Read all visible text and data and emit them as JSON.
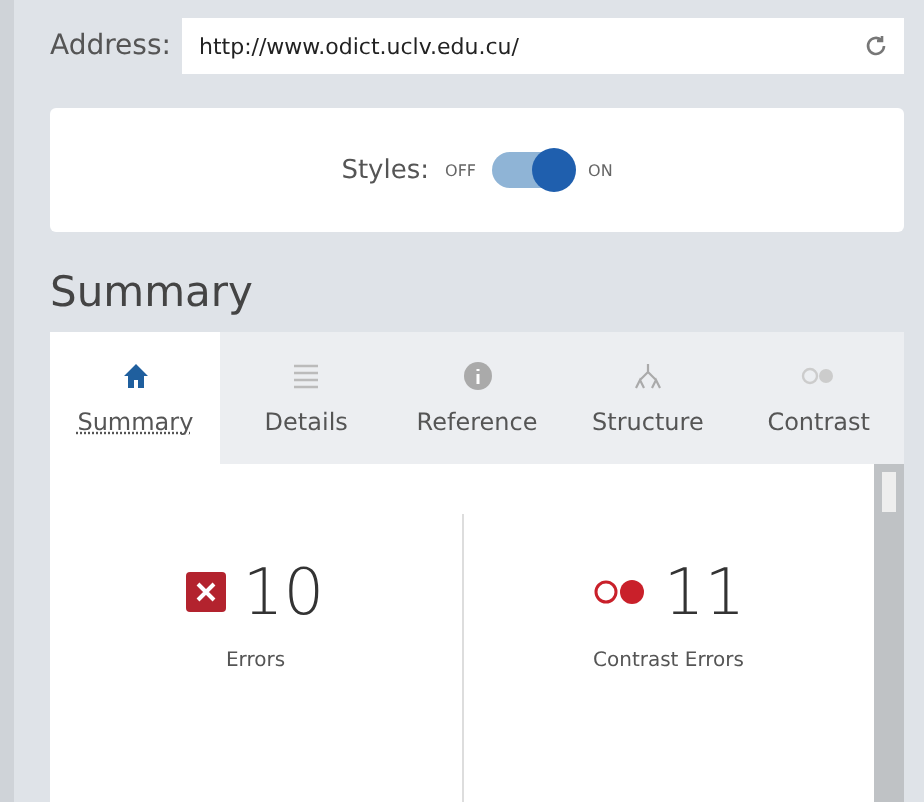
{
  "address": {
    "label": "Address:",
    "value": "http://www.odict.uclv.edu.cu/"
  },
  "styles": {
    "label": "Styles:",
    "off_label": "OFF",
    "on_label": "ON",
    "on": true
  },
  "heading": "Summary",
  "tabs": [
    {
      "label": "Summary",
      "kind": "home",
      "selected": true
    },
    {
      "label": "Details",
      "kind": "list",
      "selected": false
    },
    {
      "label": "Reference",
      "kind": "info",
      "selected": false
    },
    {
      "label": "Structure",
      "kind": "tree",
      "selected": false
    },
    {
      "label": "Contrast",
      "kind": "contrast",
      "selected": false
    }
  ],
  "stats": [
    {
      "kind": "errors",
      "count": "10",
      "label": "Errors"
    },
    {
      "kind": "contrast",
      "count": "11",
      "label": "Contrast Errors"
    }
  ]
}
